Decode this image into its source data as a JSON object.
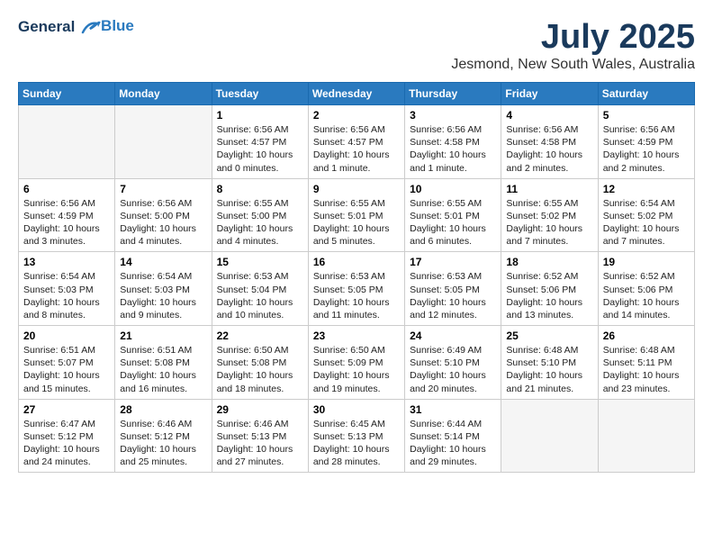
{
  "header": {
    "logo_line1": "General",
    "logo_line2": "Blue",
    "month_title": "July 2025",
    "location": "Jesmond, New South Wales, Australia"
  },
  "days_of_week": [
    "Sunday",
    "Monday",
    "Tuesday",
    "Wednesday",
    "Thursday",
    "Friday",
    "Saturday"
  ],
  "weeks": [
    [
      {
        "day": "",
        "empty": true
      },
      {
        "day": "",
        "empty": true
      },
      {
        "day": "1",
        "line1": "Sunrise: 6:56 AM",
        "line2": "Sunset: 4:57 PM",
        "line3": "Daylight: 10 hours",
        "line4": "and 0 minutes."
      },
      {
        "day": "2",
        "line1": "Sunrise: 6:56 AM",
        "line2": "Sunset: 4:57 PM",
        "line3": "Daylight: 10 hours",
        "line4": "and 1 minute."
      },
      {
        "day": "3",
        "line1": "Sunrise: 6:56 AM",
        "line2": "Sunset: 4:58 PM",
        "line3": "Daylight: 10 hours",
        "line4": "and 1 minute."
      },
      {
        "day": "4",
        "line1": "Sunrise: 6:56 AM",
        "line2": "Sunset: 4:58 PM",
        "line3": "Daylight: 10 hours",
        "line4": "and 2 minutes."
      },
      {
        "day": "5",
        "line1": "Sunrise: 6:56 AM",
        "line2": "Sunset: 4:59 PM",
        "line3": "Daylight: 10 hours",
        "line4": "and 2 minutes."
      }
    ],
    [
      {
        "day": "6",
        "line1": "Sunrise: 6:56 AM",
        "line2": "Sunset: 4:59 PM",
        "line3": "Daylight: 10 hours",
        "line4": "and 3 minutes."
      },
      {
        "day": "7",
        "line1": "Sunrise: 6:56 AM",
        "line2": "Sunset: 5:00 PM",
        "line3": "Daylight: 10 hours",
        "line4": "and 4 minutes."
      },
      {
        "day": "8",
        "line1": "Sunrise: 6:55 AM",
        "line2": "Sunset: 5:00 PM",
        "line3": "Daylight: 10 hours",
        "line4": "and 4 minutes."
      },
      {
        "day": "9",
        "line1": "Sunrise: 6:55 AM",
        "line2": "Sunset: 5:01 PM",
        "line3": "Daylight: 10 hours",
        "line4": "and 5 minutes."
      },
      {
        "day": "10",
        "line1": "Sunrise: 6:55 AM",
        "line2": "Sunset: 5:01 PM",
        "line3": "Daylight: 10 hours",
        "line4": "and 6 minutes."
      },
      {
        "day": "11",
        "line1": "Sunrise: 6:55 AM",
        "line2": "Sunset: 5:02 PM",
        "line3": "Daylight: 10 hours",
        "line4": "and 7 minutes."
      },
      {
        "day": "12",
        "line1": "Sunrise: 6:54 AM",
        "line2": "Sunset: 5:02 PM",
        "line3": "Daylight: 10 hours",
        "line4": "and 7 minutes."
      }
    ],
    [
      {
        "day": "13",
        "line1": "Sunrise: 6:54 AM",
        "line2": "Sunset: 5:03 PM",
        "line3": "Daylight: 10 hours",
        "line4": "and 8 minutes."
      },
      {
        "day": "14",
        "line1": "Sunrise: 6:54 AM",
        "line2": "Sunset: 5:03 PM",
        "line3": "Daylight: 10 hours",
        "line4": "and 9 minutes."
      },
      {
        "day": "15",
        "line1": "Sunrise: 6:53 AM",
        "line2": "Sunset: 5:04 PM",
        "line3": "Daylight: 10 hours",
        "line4": "and 10 minutes."
      },
      {
        "day": "16",
        "line1": "Sunrise: 6:53 AM",
        "line2": "Sunset: 5:05 PM",
        "line3": "Daylight: 10 hours",
        "line4": "and 11 minutes."
      },
      {
        "day": "17",
        "line1": "Sunrise: 6:53 AM",
        "line2": "Sunset: 5:05 PM",
        "line3": "Daylight: 10 hours",
        "line4": "and 12 minutes."
      },
      {
        "day": "18",
        "line1": "Sunrise: 6:52 AM",
        "line2": "Sunset: 5:06 PM",
        "line3": "Daylight: 10 hours",
        "line4": "and 13 minutes."
      },
      {
        "day": "19",
        "line1": "Sunrise: 6:52 AM",
        "line2": "Sunset: 5:06 PM",
        "line3": "Daylight: 10 hours",
        "line4": "and 14 minutes."
      }
    ],
    [
      {
        "day": "20",
        "line1": "Sunrise: 6:51 AM",
        "line2": "Sunset: 5:07 PM",
        "line3": "Daylight: 10 hours",
        "line4": "and 15 minutes."
      },
      {
        "day": "21",
        "line1": "Sunrise: 6:51 AM",
        "line2": "Sunset: 5:08 PM",
        "line3": "Daylight: 10 hours",
        "line4": "and 16 minutes."
      },
      {
        "day": "22",
        "line1": "Sunrise: 6:50 AM",
        "line2": "Sunset: 5:08 PM",
        "line3": "Daylight: 10 hours",
        "line4": "and 18 minutes."
      },
      {
        "day": "23",
        "line1": "Sunrise: 6:50 AM",
        "line2": "Sunset: 5:09 PM",
        "line3": "Daylight: 10 hours",
        "line4": "and 19 minutes."
      },
      {
        "day": "24",
        "line1": "Sunrise: 6:49 AM",
        "line2": "Sunset: 5:10 PM",
        "line3": "Daylight: 10 hours",
        "line4": "and 20 minutes."
      },
      {
        "day": "25",
        "line1": "Sunrise: 6:48 AM",
        "line2": "Sunset: 5:10 PM",
        "line3": "Daylight: 10 hours",
        "line4": "and 21 minutes."
      },
      {
        "day": "26",
        "line1": "Sunrise: 6:48 AM",
        "line2": "Sunset: 5:11 PM",
        "line3": "Daylight: 10 hours",
        "line4": "and 23 minutes."
      }
    ],
    [
      {
        "day": "27",
        "line1": "Sunrise: 6:47 AM",
        "line2": "Sunset: 5:12 PM",
        "line3": "Daylight: 10 hours",
        "line4": "and 24 minutes."
      },
      {
        "day": "28",
        "line1": "Sunrise: 6:46 AM",
        "line2": "Sunset: 5:12 PM",
        "line3": "Daylight: 10 hours",
        "line4": "and 25 minutes."
      },
      {
        "day": "29",
        "line1": "Sunrise: 6:46 AM",
        "line2": "Sunset: 5:13 PM",
        "line3": "Daylight: 10 hours",
        "line4": "and 27 minutes."
      },
      {
        "day": "30",
        "line1": "Sunrise: 6:45 AM",
        "line2": "Sunset: 5:13 PM",
        "line3": "Daylight: 10 hours",
        "line4": "and 28 minutes."
      },
      {
        "day": "31",
        "line1": "Sunrise: 6:44 AM",
        "line2": "Sunset: 5:14 PM",
        "line3": "Daylight: 10 hours",
        "line4": "and 29 minutes."
      },
      {
        "day": "",
        "empty": true
      },
      {
        "day": "",
        "empty": true
      }
    ]
  ]
}
